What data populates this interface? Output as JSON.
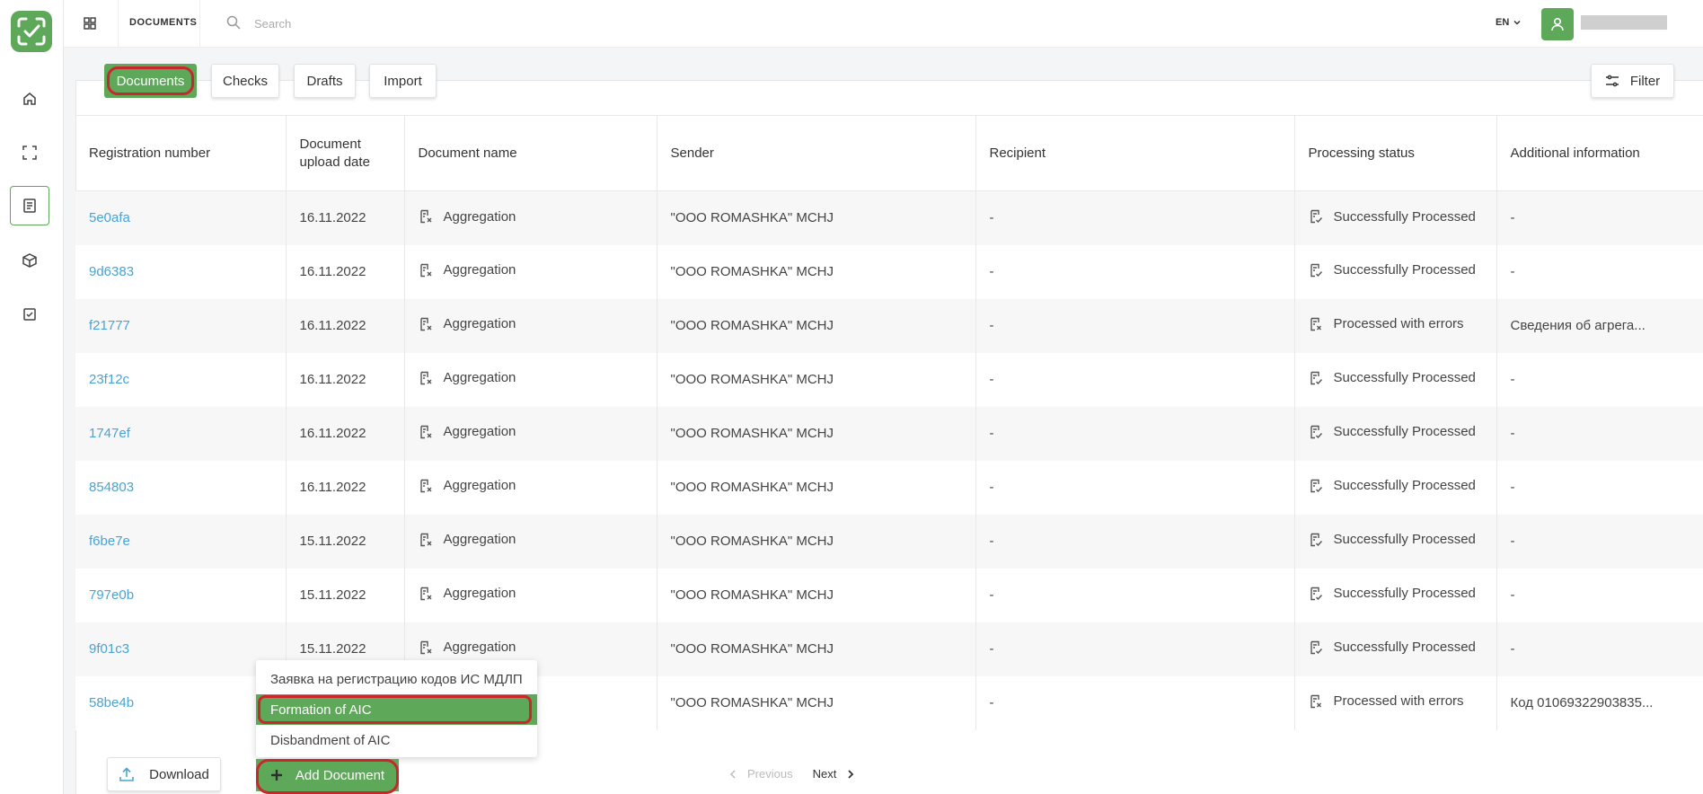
{
  "topbar": {
    "section_title": "DOCUMENTS",
    "search_placeholder": "Search",
    "language": "EN"
  },
  "tabs": [
    {
      "label": "Documents",
      "active": true
    },
    {
      "label": "Checks",
      "active": false
    },
    {
      "label": "Drafts",
      "active": false
    },
    {
      "label": "Import",
      "active": false
    }
  ],
  "filter_label": "Filter",
  "table": {
    "columns": [
      "Registration number",
      "Document upload date",
      "Document name",
      "Sender",
      "Recipient",
      "Processing status",
      "Additional information"
    ],
    "rows": [
      {
        "reg": "5e0afa",
        "date": "16.11.2022",
        "name": "Aggregation",
        "sender": "\"OOO ROMASHKA\" MCHJ",
        "recipient": "-",
        "status": "Successfully Processed",
        "info": "-"
      },
      {
        "reg": "9d6383",
        "date": "16.11.2022",
        "name": "Aggregation",
        "sender": "\"OOO ROMASHKA\" MCHJ",
        "recipient": "-",
        "status": "Successfully Processed",
        "info": "-"
      },
      {
        "reg": "f21777",
        "date": "16.11.2022",
        "name": "Aggregation",
        "sender": "\"OOO ROMASHKA\" MCHJ",
        "recipient": "-",
        "status": "Processed with errors",
        "info": "Сведения об агрега..."
      },
      {
        "reg": "23f12c",
        "date": "16.11.2022",
        "name": "Aggregation",
        "sender": "\"OOO ROMASHKA\" MCHJ",
        "recipient": "-",
        "status": "Successfully Processed",
        "info": "-"
      },
      {
        "reg": "1747ef",
        "date": "16.11.2022",
        "name": "Aggregation",
        "sender": "\"OOO ROMASHKA\" MCHJ",
        "recipient": "-",
        "status": "Successfully Processed",
        "info": "-"
      },
      {
        "reg": "854803",
        "date": "16.11.2022",
        "name": "Aggregation",
        "sender": "\"OOO ROMASHKA\" MCHJ",
        "recipient": "-",
        "status": "Successfully Processed",
        "info": "-"
      },
      {
        "reg": "f6be7e",
        "date": "15.11.2022",
        "name": "Aggregation",
        "sender": "\"OOO ROMASHKA\" MCHJ",
        "recipient": "-",
        "status": "Successfully Processed",
        "info": "-"
      },
      {
        "reg": "797e0b",
        "date": "15.11.2022",
        "name": "Aggregation",
        "sender": "\"OOO ROMASHKA\" MCHJ",
        "recipient": "-",
        "status": "Successfully Processed",
        "info": "-"
      },
      {
        "reg": "9f01c3",
        "date": "15.11.2022",
        "name": "Aggregation",
        "sender": "\"OOO ROMASHKA\" MCHJ",
        "recipient": "-",
        "status": "Successfully Processed",
        "info": "-"
      },
      {
        "reg": "58be4b",
        "date": "",
        "name": "",
        "sender": "\"OOO ROMASHKA\" MCHJ",
        "recipient": "-",
        "status": "Processed with errors",
        "info": "Код 01069322903835..."
      }
    ]
  },
  "dropdown": {
    "items": [
      {
        "label": "Заявка на регистрацию кодов ИС МДЛП",
        "selected": false
      },
      {
        "label": "Formation of AIC",
        "selected": true
      },
      {
        "label": "Disbandment of AIC",
        "selected": false
      }
    ]
  },
  "footer": {
    "download_label": "Download",
    "add_document_label": "Add Document",
    "previous_label": "Previous",
    "next_label": "Next"
  },
  "colors": {
    "accent": "#5ea85a",
    "highlight_ring": "#c8272c",
    "link": "#4aa3d4"
  }
}
